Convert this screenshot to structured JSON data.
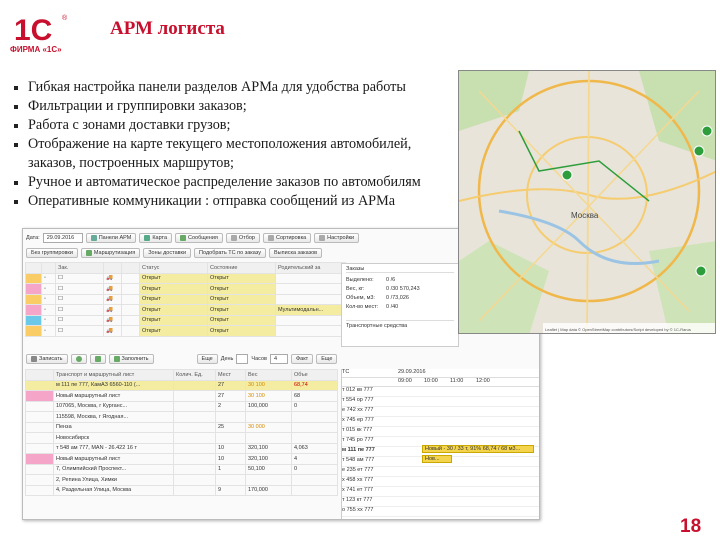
{
  "header": {
    "logo_text": "ФИРМА «1С»",
    "title": "АРМ логиста"
  },
  "bullets": [
    "Гибкая настройка панели разделов АРМа для удобства работы",
    "Фильтрации и группировки заказов;",
    "Работа с зонами доставки грузов;",
    "Отображение на карте текущего местоположения автомобилей,",
    "заказов, построенных маршрутов;",
    "Ручное и автоматическое распределение заказов по автомобилям",
    "Оперативные коммуникации : отправка сообщений из АРМа"
  ],
  "toolbar1": {
    "date_label": "Дата:",
    "date_value": "29.09.2016",
    "panel": "Панели АРМ",
    "map": "Карта",
    "messages": "Сообщения",
    "select": "Отбор",
    "sort": "Сортировка",
    "settings": "Настройки"
  },
  "toolbar2": {
    "grouping": "Без группировки",
    "routing": "Маршрутизация",
    "delivery_zones": "Зоны доставки",
    "route_by_order": "Подобрать ТС по заказу",
    "print_order": "Выписка заказов"
  },
  "orders": {
    "headers": [
      "Зак.",
      "Статус",
      "Состояние",
      "Родительский за"
    ],
    "rows": [
      {
        "status": "Открыт",
        "state": "Открыт",
        "parent": ""
      },
      {
        "status": "Открыт",
        "state": "Открыт",
        "parent": ""
      },
      {
        "status": "Открыт",
        "state": "Открыт",
        "parent": ""
      },
      {
        "status": "Открыт",
        "state": "Открыт",
        "parent": "Мультимодальн..."
      },
      {
        "status": "Открыт",
        "state": "Открыт",
        "parent": ""
      },
      {
        "status": "Открыт",
        "state": "Открыт",
        "parent": ""
      }
    ]
  },
  "orders_summary": {
    "title": "Заказы",
    "labels": [
      "Выделено:",
      "Вес, кг:",
      "Объем, м3:",
      "Кол-во мест:"
    ],
    "values": [
      "0 /6",
      "0 /30 570,243",
      "0 /73,026",
      "0 /40"
    ],
    "transport": "Транспортные средства"
  },
  "toolbar3": {
    "save": "Записать",
    "fill": "Заполнить",
    "more": "Еще",
    "day": "День",
    "hours": "Часов",
    "hours_value": "4",
    "fact": "Факт",
    "more2": "Еще"
  },
  "transport": {
    "headers": [
      "Транспорт и маршрутный лист",
      "Колич. Ед.",
      "Мест",
      "Вес",
      "Объе"
    ],
    "rows": [
      {
        "name": "м 111 пе 777, КамАЗ 6560-110 (...",
        "qty": "",
        "places": "27",
        "weight": "30 100",
        "vol": "68,74",
        "hl": true
      },
      {
        "name": "Новый маршрутный лист",
        "qty": "",
        "places": "27",
        "weight": "30 100",
        "vol": "68",
        "hl": false
      },
      {
        "name": "107065, Москва, г Курганс...",
        "qty": "",
        "places": "2",
        "weight": "100,000",
        "vol": "0",
        "hl": false
      },
      {
        "name": "115598, Москва, г Ягодная...",
        "qty": "",
        "places": "",
        "weight": "",
        "vol": "",
        "hl": false
      },
      {
        "name": "Пенза",
        "qty": "",
        "places": "25",
        "weight": "30 000",
        "vol": "",
        "hl": false
      },
      {
        "name": "Новосибирск",
        "qty": "",
        "places": "",
        "weight": "",
        "vol": "",
        "hl": false
      },
      {
        "name": "т 548 ам 777, MAN - 26.422 16 т",
        "qty": "",
        "places": "10",
        "weight": "320,100",
        "vol": "4,063",
        "hl": false
      },
      {
        "name": "Новый маршрутный лист",
        "qty": "",
        "places": "10",
        "weight": "320,100",
        "vol": "4",
        "hl": false
      },
      {
        "name": "7, Олимпийский Проспект...",
        "qty": "",
        "places": "1",
        "weight": "50,100",
        "vol": "0",
        "hl": false
      },
      {
        "name": "2, Репина Улица, Химки",
        "qty": "",
        "places": "",
        "weight": "",
        "vol": "",
        "hl": false
      },
      {
        "name": "4, Раздельная Улица, Москва",
        "qty": "",
        "places": "9",
        "weight": "170,000",
        "vol": "",
        "hl": false
      }
    ]
  },
  "schedule": {
    "tc": "ТС",
    "date": "29.09.2016",
    "times": [
      "09:00",
      "10:00",
      "11:00",
      "12:00"
    ],
    "vehicles": [
      "т 012 кв 777",
      "т 554 ор 777",
      "е 742 хх 777",
      "х 745 ер 777",
      "т 015 кк 777",
      "т 745 ро 777",
      "м 111 пе 777",
      "т 548 ам 777",
      "е 235 ет 777",
      "х 458 хх 777",
      "х 741 ет 777",
      "т 123 кт 777",
      "о 755 хх 777"
    ],
    "bar1": "Новый - 30 / 33 т, 91% 68,74 / 68 м3...",
    "bar2": "Нов..."
  },
  "map": {
    "city": "Москва",
    "credit": "Leaflet | Map data © OpenStreetMap contributors/Script developed by © 1C-Rarus"
  },
  "page_number": "18",
  "colors": {
    "accent": "#c8102e",
    "highlight": "#f4eca0",
    "pink": "#f5a6c8",
    "map_bg": "#e6e2d8"
  }
}
